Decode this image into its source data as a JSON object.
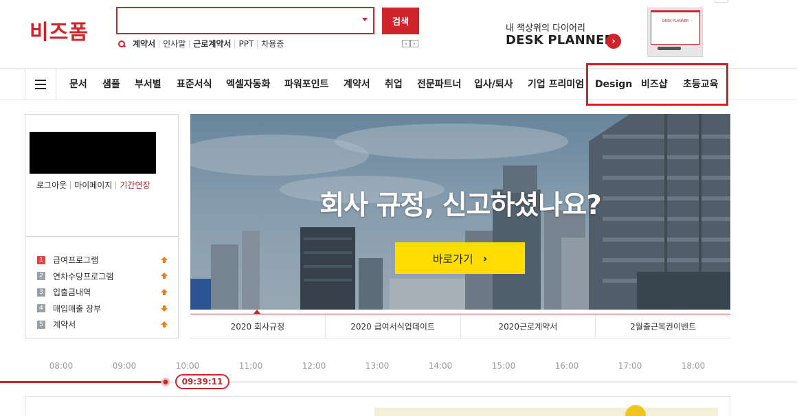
{
  "header": {
    "logo": "비즈폼",
    "search": {
      "value": "",
      "placeholder": "",
      "button_label": "검색"
    },
    "keywords": [
      {
        "label": "계약서",
        "bold": true
      },
      {
        "label": "인사말",
        "bold": false
      },
      {
        "label": "근로계약서",
        "bold": true
      },
      {
        "label": "PPT",
        "bold": false
      },
      {
        "label": "차용증",
        "bold": false
      }
    ],
    "keyword_prev": "‹",
    "keyword_next": "›",
    "promo": {
      "line1": "내 책상위의 다이어리",
      "line2": "DESK PLANNER",
      "go_icon": "chevron-right-circle-icon",
      "image_caption": "DESK PLANNER"
    }
  },
  "nav": {
    "menu_icon": "hamburger-icon",
    "items": [
      "문서",
      "샘플",
      "부서별",
      "표준서식",
      "엑셀자동화",
      "파워포인트",
      "계약서",
      "취업",
      "전문파트너",
      "입사/퇴사",
      "기업 프리미엄",
      "Design",
      "비즈샵",
      "초등교육"
    ],
    "annotation_color": "#e01b22"
  },
  "user_panel": {
    "links": [
      "로그아웃",
      "마이페이지",
      "기간연장"
    ]
  },
  "ranking": {
    "items": [
      {
        "rank": "1",
        "label": "급여프로그램",
        "trend": "up"
      },
      {
        "rank": "2",
        "label": "연차수당프로그램",
        "trend": "up"
      },
      {
        "rank": "3",
        "label": "입출금내역",
        "trend": "up"
      },
      {
        "rank": "4",
        "label": "매입매출 장부",
        "trend": "down"
      },
      {
        "rank": "5",
        "label": "계약서",
        "trend": "up"
      }
    ]
  },
  "banner": {
    "title": "회사 규정, 신고하셨나요?",
    "button_label": "바로가기",
    "button_icon": "›",
    "tabs": [
      "2020 회사규정",
      "2020 급여서식업데이트",
      "2020근로계약서",
      "2월출근복권이벤트"
    ]
  },
  "timeline": {
    "labels": [
      "08:00",
      "09:00",
      "10:00",
      "11:00",
      "12:00",
      "13:00",
      "14:00",
      "15:00",
      "16:00",
      "17:00",
      "18:00"
    ],
    "current_time": "09:39:11"
  },
  "colors": {
    "brand_red": "#d0242b",
    "button_yellow": "#ffdd00"
  }
}
